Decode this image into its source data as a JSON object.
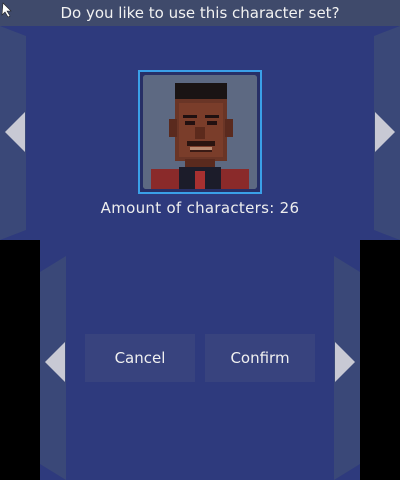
{
  "top_screen": {
    "title": "Do you like to use this character set?",
    "amount_text": "Amount of characters: 26",
    "portrait_icon": "character-portrait",
    "pointer_icon": "pointer-arrow-icon"
  },
  "bottom_screen": {
    "cancel_label": "Cancel",
    "confirm_label": "Confirm"
  },
  "colors": {
    "background": "#2e3a7d",
    "title_bar": "#3f4a6b",
    "side_panel": "#3a4878",
    "button": "#38437e",
    "portrait_border": "#3aa0e8",
    "arrow": "#c8c9d4"
  }
}
